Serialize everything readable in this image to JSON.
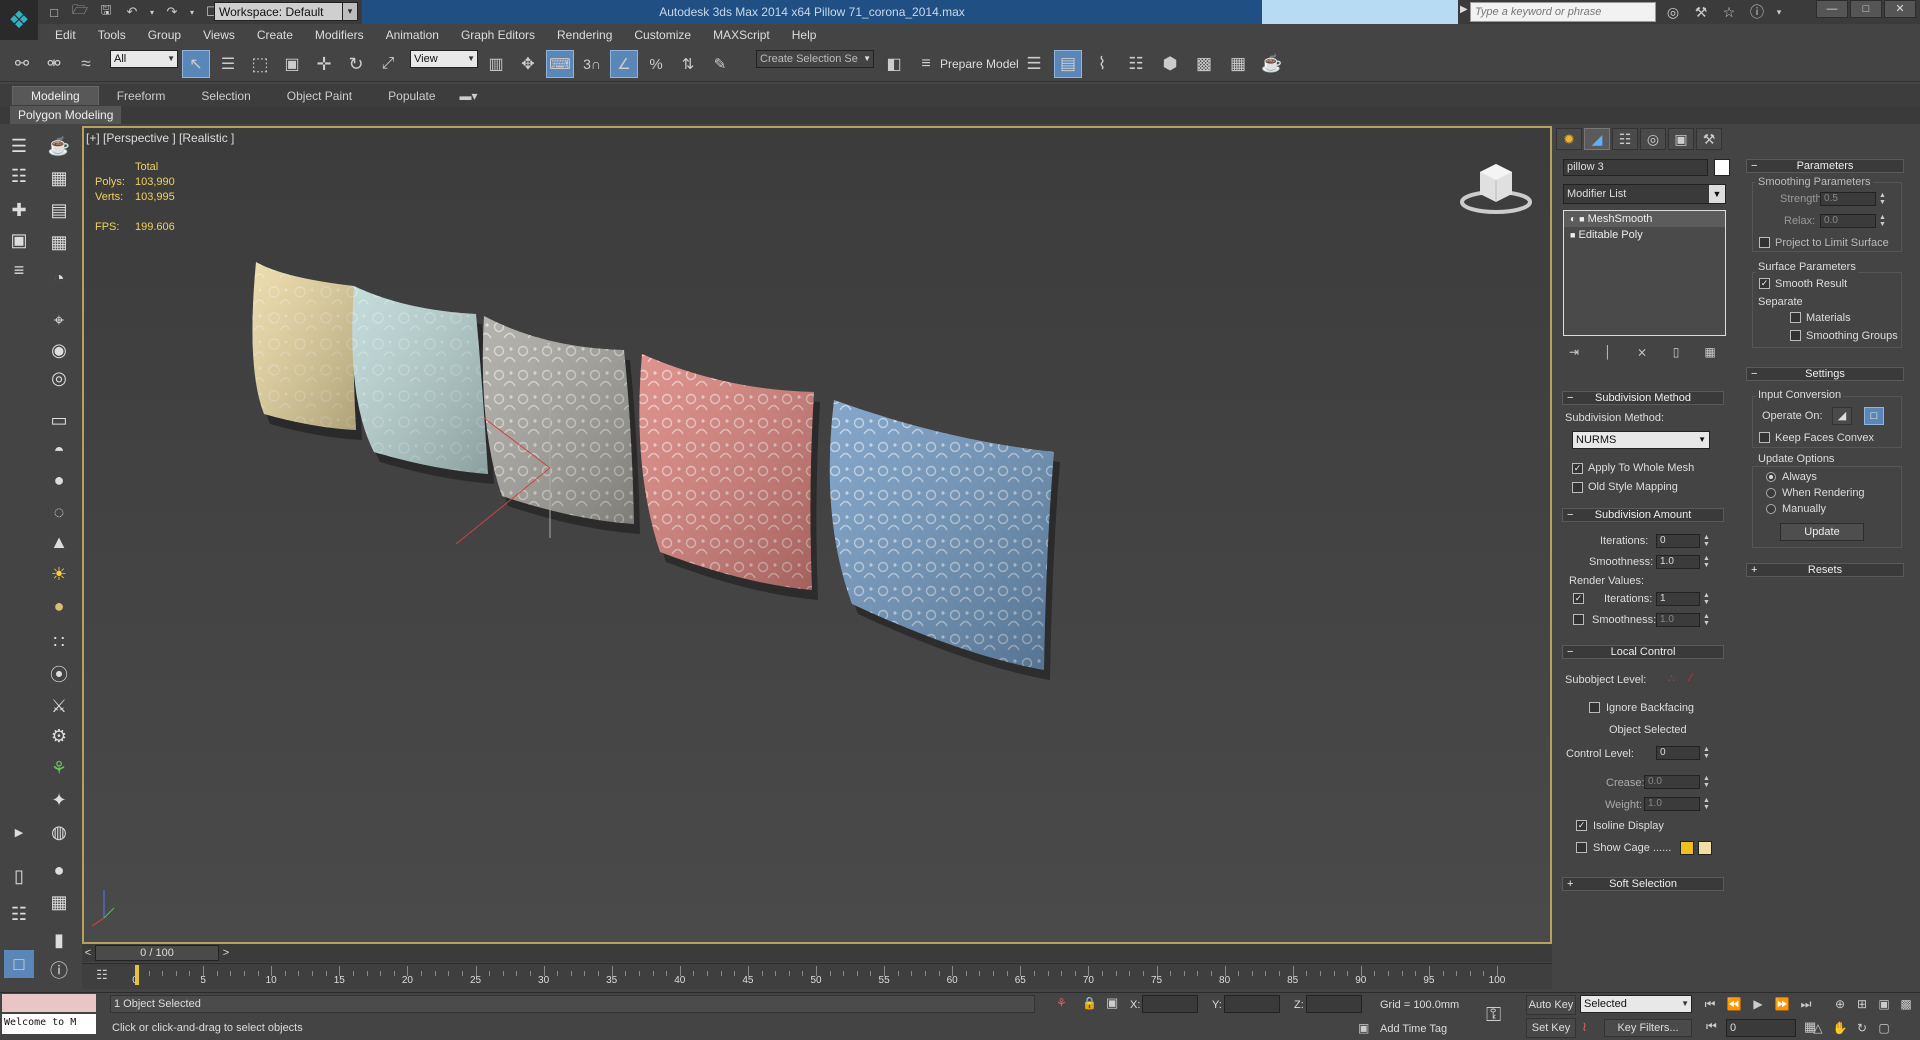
{
  "window": {
    "title": "Autodesk 3ds Max  2014 x64    Pillow 71_corona_2014.max",
    "workspace": "Workspace: Default",
    "search_placeholder": "Type a keyword or phrase"
  },
  "menu": [
    "Edit",
    "Tools",
    "Group",
    "Views",
    "Create",
    "Modifiers",
    "Animation",
    "Graph Editors",
    "Rendering",
    "Customize",
    "MAXScript",
    "Help"
  ],
  "toolbar": {
    "filter_select": "All",
    "ref_coord": "View",
    "named_selection": "Create Selection Se",
    "prepare_model": "Prepare Model",
    "snap_label": "3"
  },
  "ribbon": {
    "tabs": [
      "Modeling",
      "Freeform",
      "Selection",
      "Object Paint",
      "Populate"
    ],
    "panel_title": "Polygon Modeling"
  },
  "viewport": {
    "label": "[+] [Perspective ] [Realistic ]",
    "stats_header": "Total",
    "polys_label": "Polys:",
    "polys_value": "103,990",
    "verts_label": "Verts:",
    "verts_value": "103,995",
    "fps_label": "FPS:",
    "fps_value": "199.606",
    "pillow_colors": [
      "#e8d7a0",
      "#b9d6d4",
      "#a8a6a0",
      "#d9807a",
      "#6f97c0"
    ],
    "axis_z": "z"
  },
  "timeline": {
    "slider": "0 / 100",
    "ticks": [
      "0",
      "5",
      "10",
      "15",
      "20",
      "25",
      "30",
      "35",
      "40",
      "45",
      "50",
      "55",
      "60",
      "65",
      "70",
      "75",
      "80",
      "85",
      "90",
      "95",
      "100"
    ]
  },
  "command_panel": {
    "object_name": "pillow 3",
    "modifier_list": "Modifier List",
    "stack": [
      "MeshSmooth",
      "Editable Poly"
    ],
    "subdivision_method": {
      "title": "Subdivision Method",
      "label": "Subdivision Method:",
      "value": "NURMS",
      "apply_whole_mesh": "Apply To Whole Mesh",
      "old_style": "Old Style Mapping"
    },
    "subdivision_amount": {
      "title": "Subdivision Amount",
      "iterations_label": "Iterations:",
      "iterations": "0",
      "smoothness_label": "Smoothness:",
      "smoothness": "1.0",
      "render_values": "Render Values:",
      "r_iterations": "1",
      "r_smoothness": "1.0"
    },
    "local_control": {
      "title": "Local Control",
      "subobject_level": "Subobject Level:",
      "ignore_backfacing": "Ignore Backfacing",
      "object_selected": "Object Selected",
      "control_level_label": "Control Level:",
      "control_level": "0",
      "crease_label": "Crease:",
      "crease": "0.0",
      "weight_label": "Weight:",
      "weight": "1.0",
      "isoline_display": "Isoline Display",
      "show_cage": "Show Cage ......"
    },
    "soft_selection": "Soft Selection",
    "parameters": {
      "title": "Parameters",
      "smoothing_params": "Smoothing Parameters",
      "strength_label": "Strength:",
      "strength": "0.5",
      "relax_label": "Relax:",
      "relax": "0.0",
      "project_limit": "Project to Limit Surface",
      "surface_params": "Surface Parameters",
      "smooth_result": "Smooth Result",
      "separate": "Separate",
      "materials": "Materials",
      "smoothing_groups": "Smoothing Groups"
    },
    "settings": {
      "title": "Settings",
      "input_conversion": "Input Conversion",
      "operate_on": "Operate On:",
      "keep_faces_convex": "Keep Faces Convex",
      "update_options": "Update Options",
      "always": "Always",
      "when_rendering": "When Rendering",
      "manually": "Manually",
      "update_button": "Update"
    },
    "resets": "Resets"
  },
  "status": {
    "welcome": "Welcome to M",
    "selection": "1 Object Selected",
    "prompt": "Click or click-and-drag to select objects",
    "x_label": "X:",
    "y_label": "Y:",
    "z_label": "Z:",
    "grid": "Grid = 100.0mm",
    "add_time_tag": "Add Time Tag",
    "auto_key": "Auto Key",
    "set_key": "Set Key",
    "selected": "Selected",
    "key_filters": "Key Filters...",
    "frame": "0"
  }
}
